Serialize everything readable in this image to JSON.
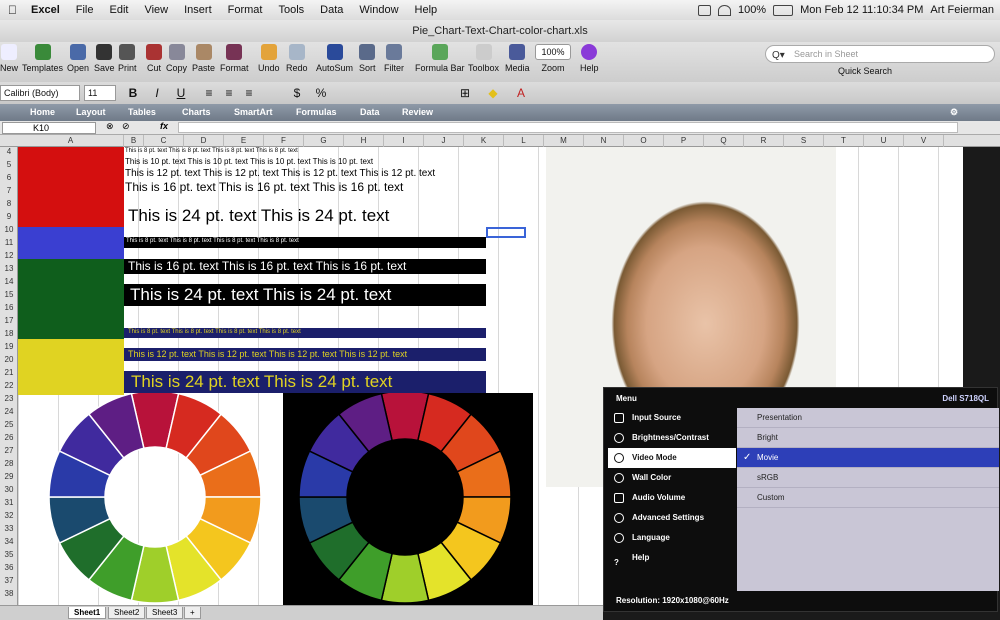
{
  "menubar": {
    "apple": "",
    "app": "Excel",
    "items": [
      "File",
      "Edit",
      "View",
      "Insert",
      "Format",
      "Tools",
      "Data",
      "Window",
      "Help"
    ],
    "battery": "100%",
    "clock": "Mon Feb 12  11:10:34 PM",
    "user": "Art Feierman"
  },
  "window": {
    "title": "Pie_Chart-Text-Chart-color-chart.xls"
  },
  "toolbar": {
    "buttons": [
      "New",
      "Templates",
      "Open",
      "Save",
      "Print",
      "Cut",
      "Copy",
      "Paste",
      "Format",
      "Undo",
      "Redo",
      "AutoSum",
      "Sort",
      "Filter",
      "Formula Bar",
      "Toolbox",
      "Media",
      "Zoom",
      "Help"
    ],
    "zoom": "100%",
    "search_placeholder": "Search in Sheet",
    "quick_search": "Quick Search"
  },
  "format_bar": {
    "font": "Calibri (Body)",
    "size": "11",
    "bold": "B",
    "italic": "I",
    "underline": "U",
    "currency": "$",
    "percent": "%"
  },
  "ribbon": {
    "tabs": [
      "Home",
      "Layout",
      "Tables",
      "Charts",
      "SmartArt",
      "Formulas",
      "Data",
      "Review"
    ]
  },
  "formula_bar": {
    "cell_ref": "K10",
    "fx": "fx"
  },
  "columns": [
    "A",
    "B",
    "C",
    "D",
    "E",
    "F",
    "G",
    "H",
    "I",
    "J",
    "K",
    "L",
    "M",
    "N",
    "O",
    "P",
    "Q",
    "R",
    "S",
    "T",
    "U",
    "V"
  ],
  "rows": [
    "4",
    "5",
    "6",
    "7",
    "8",
    "9",
    "10",
    "11",
    "12",
    "13",
    "14",
    "15",
    "16",
    "17",
    "18",
    "19",
    "20",
    "21",
    "22",
    "23",
    "24",
    "25",
    "26",
    "27",
    "28",
    "29",
    "30",
    "31",
    "32",
    "33",
    "34",
    "35",
    "36",
    "37",
    "38"
  ],
  "sheet_text": {
    "white8": "This is 8 pt. text   This is 8 pt. text   This is 8 pt. text   This is 8 pt. text",
    "white10": "This is 10 pt. text   This is 10 pt. text   This is 10 pt. text   This is 10 pt. text",
    "white12": "This is 12 pt. text   This is 12 pt. text   This is 12 pt. text   This is 12 pt. text",
    "white16": "This is 16 pt. text   This is 16 pt. text   This is 16 pt. text",
    "white24": "This is 24 pt. text   This is 24 pt. text",
    "black8": "This is 8 pt. text   This is 8 pt. text   This is 8 pt. text   This is 8 pt. text",
    "black16": "This is 16 pt. text   This is 16 pt. text   This is 16 pt. text",
    "black24": "This is 24 pt. text   This is 24 pt. text",
    "navy8": "This is 8 pt. text   This is 8 pt. text   This is 8 pt. text   This is 8 pt. text",
    "navy12": "This is 12 pt. text   This is 12 pt. text   This is 12 pt. text   This is 12 pt. text",
    "navy24": "This is 24 pt. text   This is 24 pt. text"
  },
  "colors": {
    "red": "#d40f0f",
    "blue": "#3a3fd1",
    "green": "#0f5e1c",
    "yellow": "#e0d322",
    "navy": "#1b1f6b",
    "wheel": [
      "#b8123a",
      "#d62a20",
      "#e0471c",
      "#ea6e1a",
      "#f29b1d",
      "#f4c61e",
      "#e4e32a",
      "#9fcf2a",
      "#3f9e2a",
      "#1f6e2b",
      "#1a4a6e",
      "#2a3aa8",
      "#402a9e",
      "#5e1e84"
    ]
  },
  "osd": {
    "menu": "Menu",
    "brand": "Dell S718QL",
    "items": [
      "Input Source",
      "Brightness/Contrast",
      "Video Mode",
      "Wall Color",
      "Audio Volume",
      "Advanced Settings",
      "Language",
      "Help"
    ],
    "options": [
      "Presentation",
      "Bright",
      "Movie",
      "sRGB",
      "Custom"
    ],
    "check": "✓",
    "resolution": "Resolution:  1920x1080@60Hz"
  },
  "sheet_tabs": [
    "Sheet1",
    "Sheet2",
    "Sheet3",
    "+"
  ]
}
